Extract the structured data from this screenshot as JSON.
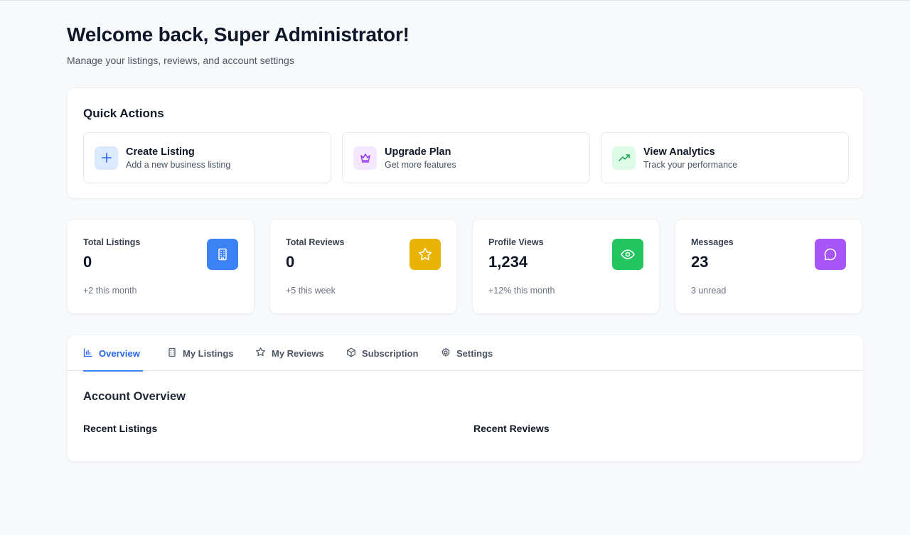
{
  "header": {
    "title": "Welcome back, Super Administrator!",
    "subtitle": "Manage your listings, reviews, and account settings"
  },
  "quick_actions": {
    "title": "Quick Actions",
    "items": [
      {
        "label": "Create Listing",
        "description": "Add a new business listing",
        "icon": "plus-icon",
        "icon_bg": "#dbeafe",
        "icon_color": "#2563eb"
      },
      {
        "label": "Upgrade Plan",
        "description": "Get more features",
        "icon": "crown-icon",
        "icon_bg": "#f3e8ff",
        "icon_color": "#9333ea"
      },
      {
        "label": "View Analytics",
        "description": "Track your performance",
        "icon": "trending-up-icon",
        "icon_bg": "#dcfce7",
        "icon_color": "#16a34a"
      }
    ]
  },
  "stats": [
    {
      "label": "Total Listings",
      "value": "0",
      "note": "+2 this month",
      "icon": "building-icon",
      "color": "#3b82f6"
    },
    {
      "label": "Total Reviews",
      "value": "0",
      "note": "+5 this week",
      "icon": "star-icon",
      "color": "#eab308"
    },
    {
      "label": "Profile Views",
      "value": "1,234",
      "note": "+12% this month",
      "icon": "eye-icon",
      "color": "#22c55e"
    },
    {
      "label": "Messages",
      "value": "23",
      "note": "3 unread",
      "icon": "message-icon",
      "color": "#a855f7"
    }
  ],
  "tabs": [
    {
      "label": "Overview",
      "icon": "bar-chart-icon",
      "active": true
    },
    {
      "label": "My Listings",
      "icon": "building-icon",
      "active": false
    },
    {
      "label": "My Reviews",
      "icon": "star-icon",
      "active": false
    },
    {
      "label": "Subscription",
      "icon": "package-icon",
      "active": false
    },
    {
      "label": "Settings",
      "icon": "gear-icon",
      "active": false
    }
  ],
  "overview": {
    "title": "Account Overview",
    "recent_listings": "Recent Listings",
    "recent_reviews": "Recent Reviews"
  }
}
